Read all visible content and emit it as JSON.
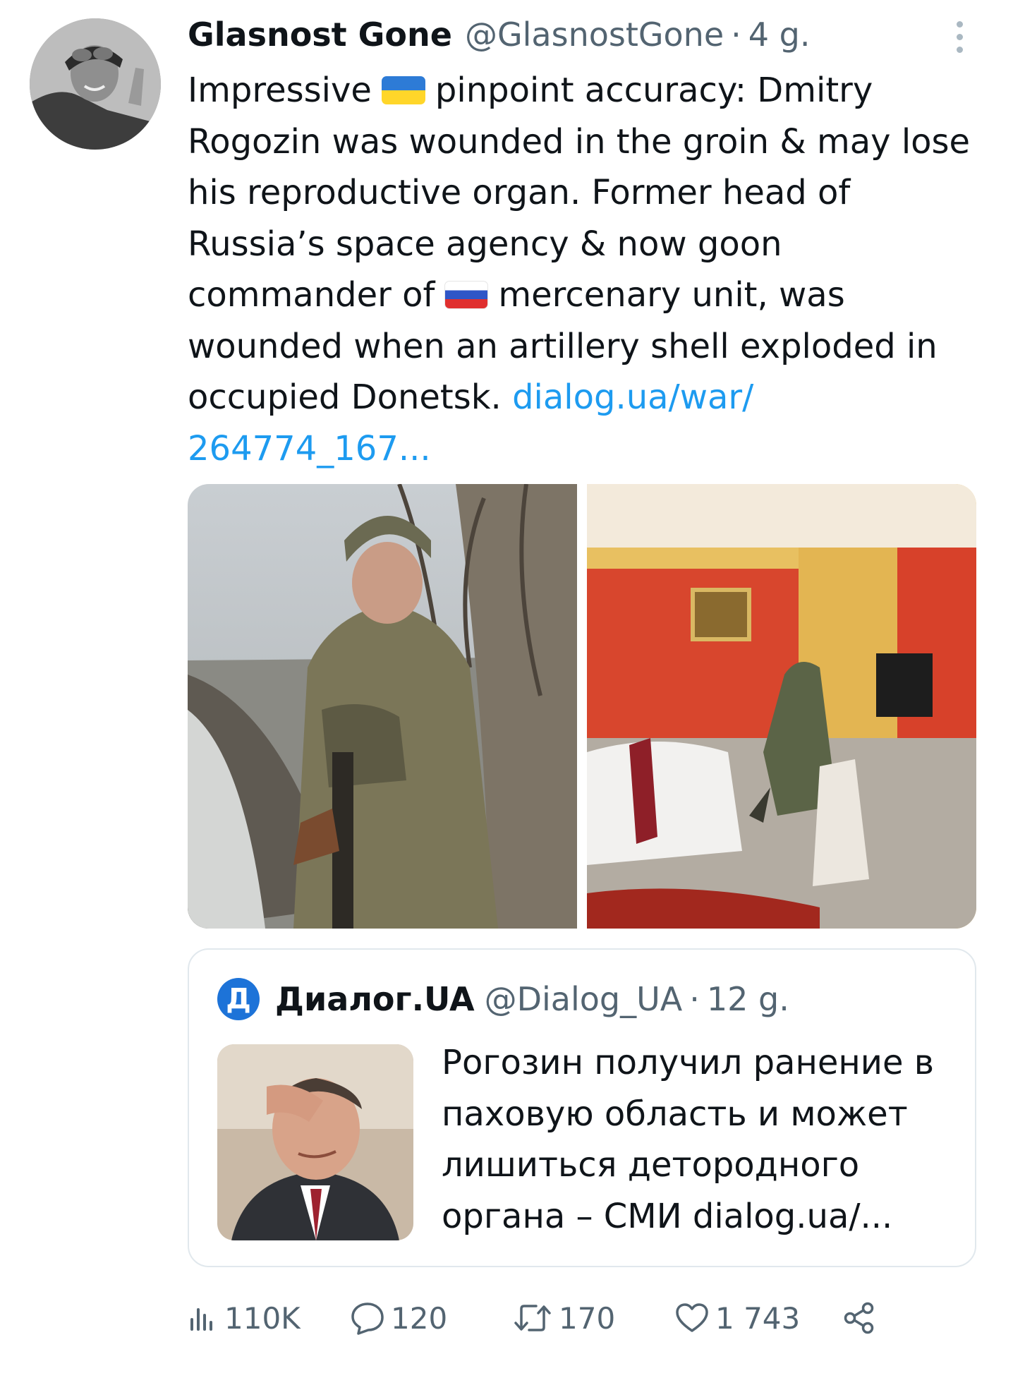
{
  "tweet": {
    "author": {
      "display_name": "Glasnost Gone",
      "handle": "@GlasnostGone",
      "separator": "·",
      "time": "4 g."
    },
    "text": {
      "l1_a": "Impressive",
      "l1_b": "pinpoint accuracy: Dmitry",
      "l2": "Rogozin was wounded in the groin & may lose",
      "l3": "his reproductive organ. Former head of",
      "l4": "Russia’s space agency & now goon",
      "l5_a": "commander of",
      "l5_b": "mercenary unit, was",
      "l6": "wounded when an artillery shell exploded in",
      "l7_a": "occupied Donetsk.",
      "link_part1": "dialog.ua/war/",
      "link_part2": "264774_167..."
    },
    "flags": [
      "ukraine-flag",
      "russia-flag"
    ]
  },
  "quoted": {
    "avatar_letter": "Д",
    "display_name": "Диалог.UA",
    "handle": "@Dialog_UA",
    "separator": "·",
    "time": "12 g.",
    "text": {
      "l1": "Рогозин получил ранение в",
      "l2": "паховую область и может",
      "l3": "лишиться детородного",
      "l4": "органа – СМИ   dialog.ua/..."
    }
  },
  "actions": {
    "views": "110K",
    "replies": "120",
    "retweets": "170",
    "likes": "1 743"
  },
  "colors": {
    "text": "#0f1419",
    "secondary": "#536471",
    "link": "#1d9bf0",
    "border": "#e1e8ed",
    "dialog_brand": "#1d73d8"
  },
  "icons": [
    "more-vertical-icon",
    "views-icon",
    "reply-icon",
    "retweet-icon",
    "like-icon",
    "share-icon"
  ]
}
